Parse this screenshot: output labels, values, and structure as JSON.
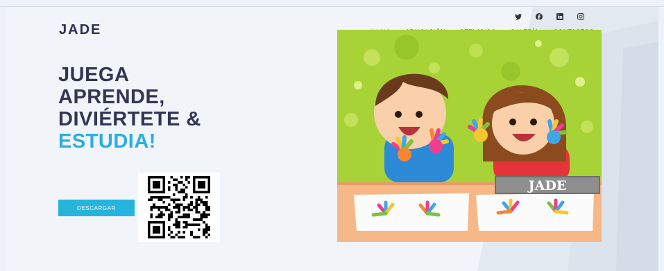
{
  "brand": {
    "logo": "JADE"
  },
  "social": [
    "twitter-icon",
    "facebook-icon",
    "linkedin-icon",
    "instagram-icon"
  ],
  "nav": [
    {
      "label": "INICIO",
      "active": true
    },
    {
      "label": "APLICACIÓN"
    },
    {
      "label": "SERVICIOS"
    },
    {
      "label": "GALERÍA"
    },
    {
      "label": "CONTACTOS"
    }
  ],
  "hero": {
    "line1": "JUEGA",
    "line2": "APRENDE,",
    "line3": "DIVIÉRTETE &",
    "line4": "ESTUDIA!",
    "image_sign": "JADE"
  },
  "cta": {
    "download_label": "DESCARGAR"
  },
  "colors": {
    "accent": "#26b4dc",
    "heading": "#343454",
    "background": "#f1f4f9",
    "image_bg": "#a7d336"
  }
}
